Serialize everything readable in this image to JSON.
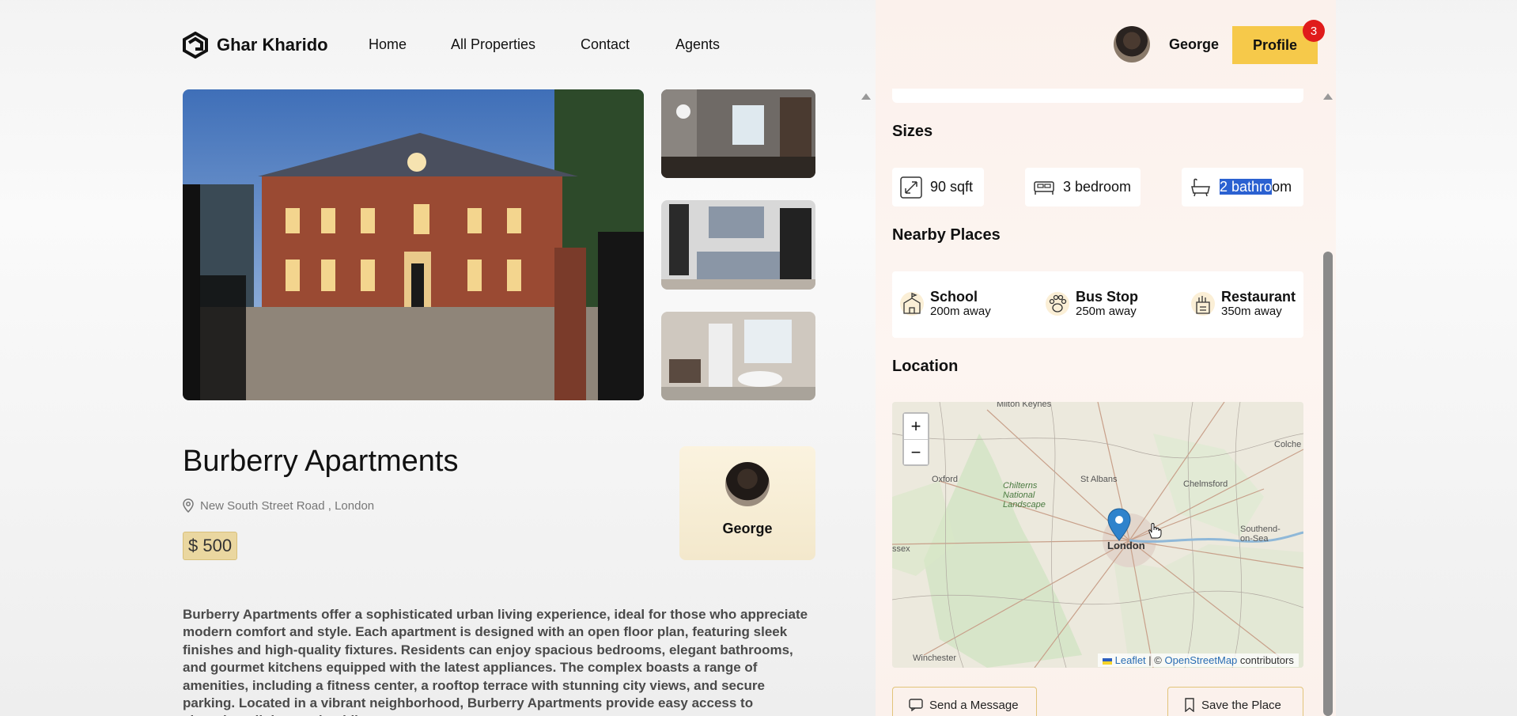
{
  "brand": {
    "name": "Ghar Kharido"
  },
  "nav": [
    "Home",
    "All Properties",
    "Contact",
    "Agents"
  ],
  "user": {
    "name": "George",
    "profile_label": "Profile",
    "notifications": "3"
  },
  "property": {
    "title": "Burberry Apartments",
    "address": "New South Street Road , London",
    "price": "$ 500",
    "agent": "George",
    "description": "Burberry Apartments offer a sophisticated urban living experience, ideal for those who appreciate modern comfort and style. Each apartment is designed with an open floor plan, featuring sleek finishes and high-quality fixtures. Residents can enjoy spacious bedrooms, elegant bathrooms, and gourmet kitchens equipped with the latest appliances. The complex boasts a range of amenities, including a fitness center, a rooftop terrace with stunning city views, and secure parking. Located in a vibrant neighborhood, Burberry Apartments provide easy access to shopping, dining, and public"
  },
  "sizes": {
    "title": "Sizes",
    "area": "90 sqft",
    "bedrooms": "3 bedroom",
    "bathrooms_selected": "2 bathro",
    "bathrooms_rest": "om"
  },
  "nearby": {
    "title": "Nearby Places",
    "items": [
      {
        "name": "School",
        "distance": "200m away"
      },
      {
        "name": "Bus Stop",
        "distance": "250m away"
      },
      {
        "name": "Restaurant",
        "distance": "350m away"
      }
    ]
  },
  "location": {
    "title": "Location",
    "zoom_in": "+",
    "zoom_out": "−",
    "attribution": {
      "leaflet": "Leaflet",
      "sep": "| ©",
      "osm": "OpenStreetMap",
      "suffix": "contributors"
    },
    "labels": [
      "Milton Keynes",
      "Oxford",
      "Chilterns National Landscape",
      "St Albans",
      "Chelmsford",
      "Colche",
      "London",
      "Southend-on-Sea",
      "Winchester",
      "ssex"
    ]
  },
  "actions": {
    "message": "Send a Message",
    "save": "Save the Place"
  },
  "colors": {
    "accent": "#f6c94a",
    "badge": "#e01b1b",
    "selection": "#2b61d1",
    "panel": "#fbf1ec"
  }
}
